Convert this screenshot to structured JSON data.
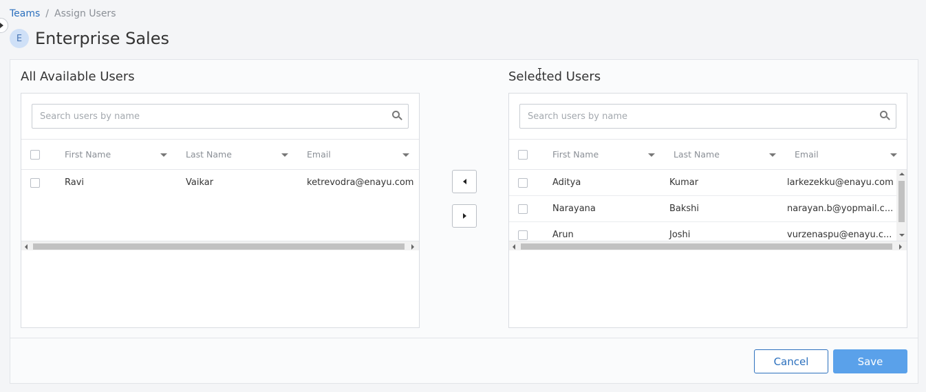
{
  "breadcrumb": {
    "parent": "Teams",
    "separator": "/",
    "current": "Assign Users"
  },
  "team": {
    "avatar_letter": "E",
    "name": "Enterprise Sales"
  },
  "available": {
    "title": "All Available Users",
    "search_placeholder": "Search users by name",
    "columns": {
      "first": "First Name",
      "last": "Last Name",
      "email": "Email"
    },
    "rows": [
      {
        "first": "Ravi",
        "last": "Vaikar",
        "email": "ketrevodra@enayu.com"
      }
    ]
  },
  "selected": {
    "title": "Selected Users",
    "search_placeholder": "Search users by name",
    "columns": {
      "first": "First Name",
      "last": "Last Name",
      "email": "Email"
    },
    "rows": [
      {
        "first": "Aditya",
        "last": "Kumar",
        "email": "larkezekku@enayu.com"
      },
      {
        "first": "Narayana",
        "last": "Bakshi",
        "email": "narayan.b@yopmail.c..."
      },
      {
        "first": "Arun",
        "last": "Joshi",
        "email": "vurzenaspu@enayu.c..."
      }
    ]
  },
  "actions": {
    "cancel": "Cancel",
    "save": "Save"
  },
  "icons": {
    "search": "search-icon",
    "move_left": "caret-left-icon",
    "move_right": "caret-right-icon",
    "sort": "sort-caret-icon"
  },
  "colors": {
    "link": "#2a6fbd",
    "primary": "#5aa1ea",
    "avatar_bg": "#cfe0f7"
  }
}
